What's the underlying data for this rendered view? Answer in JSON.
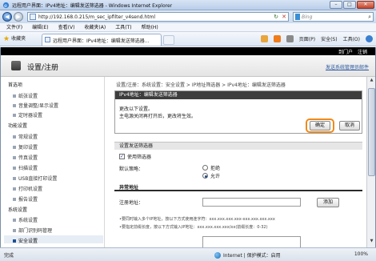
{
  "window": {
    "title": "远程用户界面：IPv4地址：编辑发送筛选器 - Windows Internet Explorer",
    "min_label": "–",
    "max_label": "□",
    "close_label": "✕"
  },
  "address": {
    "url": "http://192.168.0.215/m_sec_ipfilter_v4send.html",
    "search_placeholder": "Bing"
  },
  "menu": [
    "文件(F)",
    "编辑(E)",
    "查看(V)",
    "收藏夹(A)",
    "工具(T)",
    "帮助(H)"
  ],
  "favorites": {
    "label": "收藏夹",
    "tab_label": "远程用户界面：IPv4地址：编辑发送筛选器...",
    "tools": [
      "页面(P)",
      "安全(S)",
      "工具(O)"
    ]
  },
  "page": {
    "top_links": [
      "到门户",
      "注销"
    ],
    "header_title": "设置/注册",
    "header_link": "发送系统管理员邮件",
    "breadcrumb": "设置/注册：系统设置：安全设置 > IP地址筛选器 > IPv4地址：编辑发送筛选器",
    "sidebar": {
      "sections": [
        {
          "title": "首选项",
          "items": [
            "纸张设置",
            "音量调整/显示设置",
            "定时器设置"
          ]
        },
        {
          "title": "功能设置",
          "items": [
            "常规设置",
            "复印设置",
            "传真设置",
            "扫描设置",
            "USB直接打印设置",
            "打印机设置",
            "报告设置"
          ]
        },
        {
          "title": "系统设置",
          "items": [
            "系统设置",
            "部门识别码管理",
            "安全设置"
          ]
        }
      ],
      "active": "安全设置"
    },
    "dialog": {
      "title": "IPv4地址：编辑发送筛选器",
      "message1": "更改以下设置。",
      "message2": "主电源关闭再打开后，更改将生效。",
      "ok_label": "确定",
      "cancel_label": "取消"
    },
    "filter_section": {
      "title": "设置发送筛选器",
      "use_filter_label": "使用筛选器",
      "use_filter_checked": true,
      "default_policy_label": "默认策略：",
      "reject_label": "拒绝",
      "allow_label": "允许",
      "selected": "允许"
    },
    "exception_section": {
      "title": "异常地址",
      "register_label": "注册地址：",
      "add_label": "添加",
      "hint1": "•要同时输入多个IP地址，按以下方式使用连字符：xxx.xxx.xxx.xxx-xxx.xxx.xxx.xxx",
      "hint2": "•要指定前缀长度，按以下方式输入IP地址：xxx.xxx.xxx.xxx/xx(前缀长度：0-32)"
    }
  },
  "statusbar": {
    "status": "完成",
    "zone": "Internet | 保护模式：启用",
    "zoom": "100%"
  }
}
